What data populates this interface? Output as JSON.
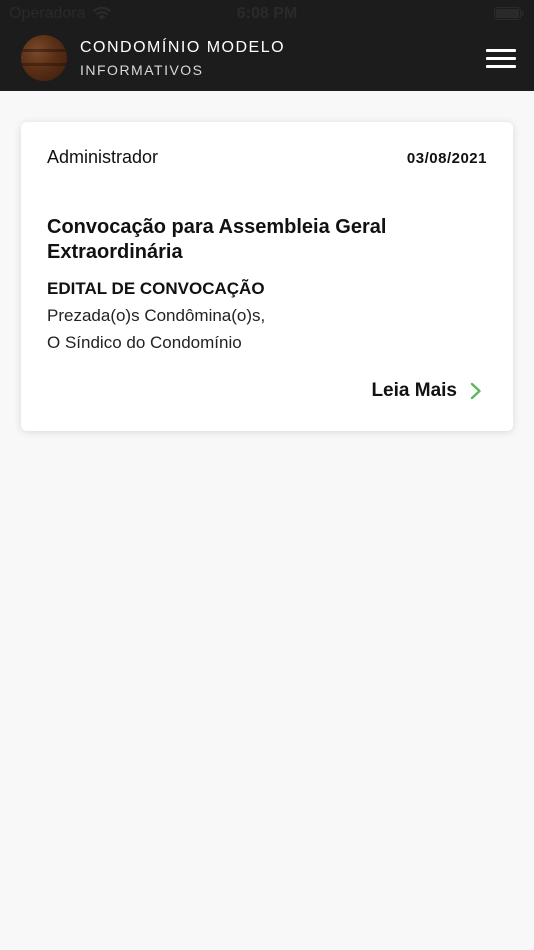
{
  "status_bar": {
    "carrier": "Operadora",
    "time": "6:08 PM"
  },
  "header": {
    "title": "CONDOMÍNIO MODELO",
    "subtitle": "INFORMATIVOS",
    "menu_icon": "hamburger-menu-icon"
  },
  "post": {
    "author": "Administrador",
    "date": "03/08/2021",
    "title": "Convocação para Assembleia Geral Extraordinária",
    "heading": "EDITAL DE CONVOCAÇÃO",
    "lines": [
      "Prezada(o)s Condômina(o)s,",
      "O Síndico do Condomínio"
    ],
    "read_more_label": "Leia Mais",
    "read_more_icon": "chevron-right-icon"
  },
  "colors": {
    "header_bg": "#1c1c1c",
    "page_bg": "#f8f8f8",
    "accent_green": "#5cb85c"
  }
}
